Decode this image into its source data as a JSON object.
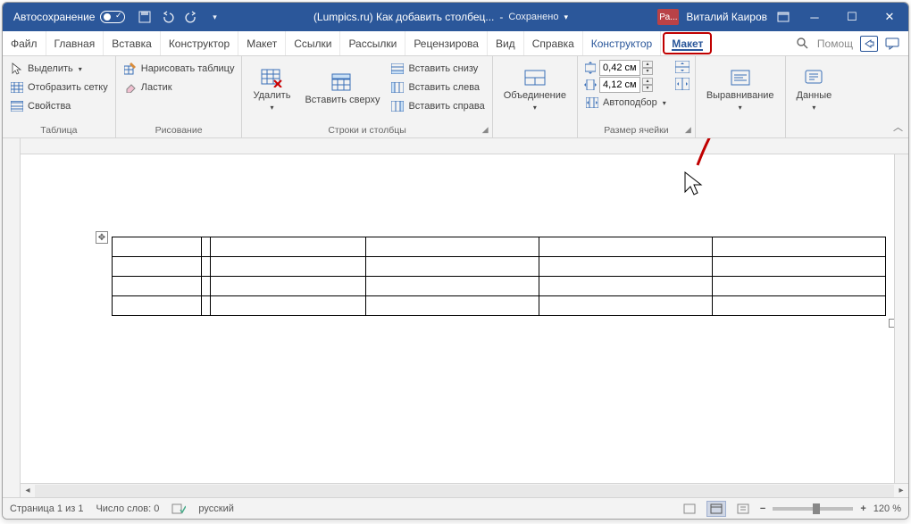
{
  "titlebar": {
    "autosave_label": "Автосохранение",
    "doc_title": "(Lumpics.ru) Как добавить столбец...",
    "saved_status": "Сохранено",
    "account_badge": "Ра...",
    "account_name": "Виталий Каиров"
  },
  "tabs": {
    "file": "Файл",
    "home": "Главная",
    "insert": "Вставка",
    "design": "Конструктор",
    "layout": "Макет",
    "references": "Ссылки",
    "mailings": "Рассылки",
    "review": "Рецензирова",
    "view": "Вид",
    "help": "Справка",
    "table_design": "Конструктор",
    "table_layout": "Макет",
    "search_placeholder": "Помощ"
  },
  "ribbon": {
    "table_group": {
      "select": "Выделить",
      "gridlines": "Отобразить сетку",
      "properties": "Свойства",
      "label": "Таблица"
    },
    "draw_group": {
      "draw": "Нарисовать таблицу",
      "eraser": "Ластик",
      "label": "Рисование"
    },
    "rowscols_group": {
      "delete": "Удалить",
      "insert_above": "Вставить сверху",
      "insert_below": "Вставить снизу",
      "insert_left": "Вставить слева",
      "insert_right": "Вставить справа",
      "label": "Строки и столбцы"
    },
    "merge_group": {
      "merge": "Объединение",
      "label": ""
    },
    "cellsize_group": {
      "height_value": "0,42 см",
      "width_value": "4,12 см",
      "autofit": "Автоподбор",
      "label": "Размер ячейки"
    },
    "align_group": {
      "alignment": "Выравнивание",
      "label": ""
    },
    "data_group": {
      "data": "Данные",
      "label": ""
    }
  },
  "statusbar": {
    "page": "Страница 1 из 1",
    "words": "Число слов: 0",
    "language": "русский",
    "zoom": "120 %"
  }
}
